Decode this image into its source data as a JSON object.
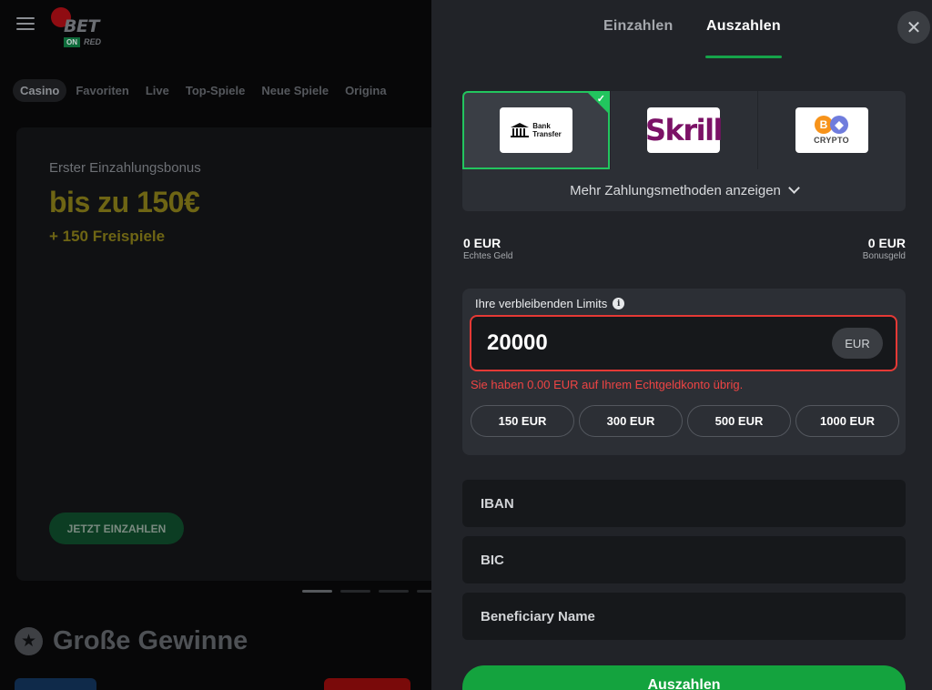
{
  "background": {
    "logo": {
      "bet": "BET",
      "on": "ON",
      "red": "RED"
    },
    "categories": [
      {
        "label": "Casino",
        "active": true
      },
      {
        "label": "Favoriten"
      },
      {
        "label": "Live"
      },
      {
        "label": "Top-Spiele"
      },
      {
        "label": "Neue Spiele"
      },
      {
        "label": "Origina"
      }
    ],
    "banner": {
      "subtitle": "Erster Einzahlungsbonus",
      "title": "bis zu 150€",
      "spins": "+ 150 Freispiele",
      "cta": "JETZT EINZAHLEN"
    },
    "section_title": "Große Gewinne"
  },
  "panel": {
    "tabs": {
      "deposit": "Einzahlen",
      "withdraw": "Auszahlen",
      "active": "withdraw"
    },
    "methods": {
      "bank": {
        "line1": "Bank",
        "line2": "Transfer",
        "selected": true
      },
      "skrill": {
        "label": "Skrill"
      },
      "crypto": {
        "label": "CRYPTO"
      },
      "more_label": "Mehr Zahlungsmethoden anzeigen"
    },
    "balance": {
      "real": {
        "value": "0 EUR",
        "label": "Echtes Geld"
      },
      "bonus": {
        "value": "0 EUR",
        "label": "Bonusgeld"
      }
    },
    "limits": {
      "title": "Ihre verbleibenden Limits",
      "amount": "20000",
      "currency": "EUR",
      "error": "Sie haben 0.00 EUR auf Ihrem Echtgeldkonto übrig.",
      "quick": [
        "150 EUR",
        "300 EUR",
        "500 EUR",
        "1000 EUR"
      ]
    },
    "fields": {
      "iban_placeholder": "IBAN",
      "bic_placeholder": "BIC",
      "name_placeholder": "Beneficiary Name"
    },
    "submit_label": "Auszahlen"
  },
  "colors": {
    "accent": "#16a34a",
    "error": "#ef4444",
    "panel": "#212328"
  }
}
